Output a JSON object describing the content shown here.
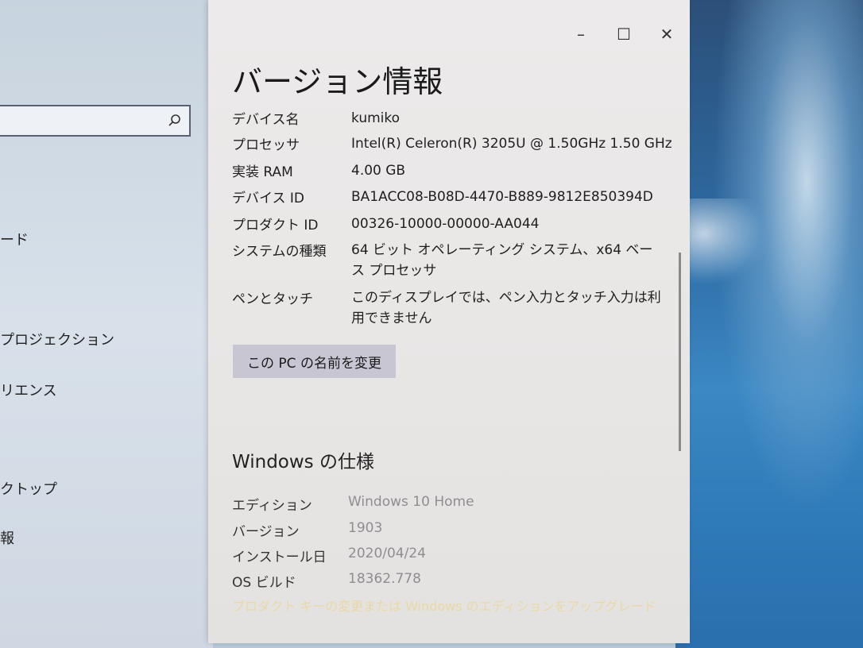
{
  "window": {
    "title": "バージョン情報",
    "controls": {
      "minimize": "–",
      "maximize": "☐",
      "close": "✕"
    }
  },
  "device_specs": [
    {
      "label": "デバイス名",
      "value": "kumiko"
    },
    {
      "label": "プロセッサ",
      "value": "Intel(R) Celeron(R) 3205U @ 1.50GHz   1.50 GHz"
    },
    {
      "label": "実装 RAM",
      "value": "4.00 GB"
    },
    {
      "label": "デバイス ID",
      "value": "BA1ACC08-B08D-4470-B889-9812E850394D"
    },
    {
      "label": "プロダクト ID",
      "value": "00326-10000-00000-AA044"
    },
    {
      "label": "システムの種類",
      "value": "64 ビット オペレーティング システム、x64 ベース プロセッサ"
    },
    {
      "label": "ペンとタッチ",
      "value": "このディスプレイでは、ペン入力とタッチ入力は利用できません"
    }
  ],
  "rename_button": "この PC の名前を変更",
  "windows_spec": {
    "title": "Windows の仕様",
    "rows": [
      {
        "label": "エディション",
        "value": "Windows 10 Home"
      },
      {
        "label": "バージョン",
        "value": "1903"
      },
      {
        "label": "インストール日",
        "value": "2020/04/24"
      },
      {
        "label": "OS ビルド",
        "value": "18362.778"
      }
    ]
  },
  "upgrade_link": "プロダクト キーの変更または Windows のエディションをアップグレード",
  "settings_sidebar": {
    "items": [
      "ード",
      "プロジェクション",
      "リエンス",
      "クトップ",
      "報"
    ]
  }
}
